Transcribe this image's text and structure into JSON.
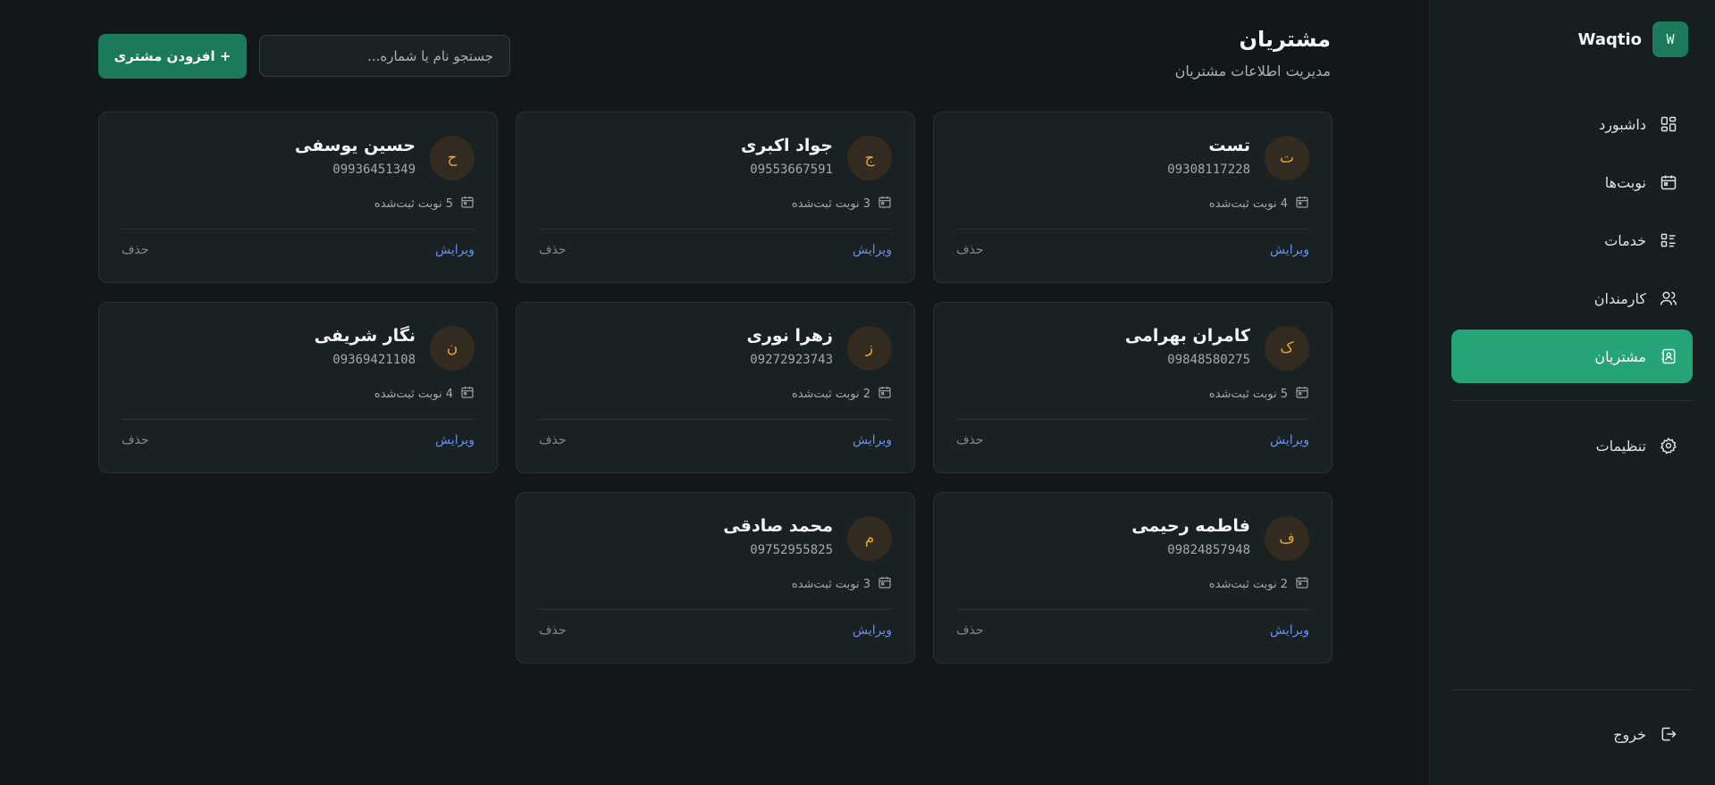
{
  "brand": {
    "logo_letter": "W",
    "name": "Waqtio"
  },
  "nav": {
    "items": [
      {
        "label": "داشبورد",
        "icon": "dashboard-icon"
      },
      {
        "label": "نوبت‌ها",
        "icon": "calendar-icon"
      },
      {
        "label": "خدمات",
        "icon": "services-list-icon"
      },
      {
        "label": "کارمندان",
        "icon": "users-icon"
      },
      {
        "label": "مشتریان",
        "icon": "contacts-book-icon",
        "active": true
      }
    ],
    "settings_label": "تنظیمات",
    "logout_label": "خروج"
  },
  "header": {
    "title": "مشتریان",
    "subtitle": "مدیریت اطلاعات مشتریان",
    "search_placeholder": "جستجو نام یا شماره...",
    "add_button": "+ افزودن مشتری"
  },
  "customers": [
    {
      "initial": "ت",
      "name": "تست",
      "phone": "09308117228",
      "appointments": "4 نوبت ثبت‌شده",
      "edit": "ویرایش",
      "delete": "حذف"
    },
    {
      "initial": "ج",
      "name": "جواد اکبری",
      "phone": "09553667591",
      "appointments": "3 نوبت ثبت‌شده",
      "edit": "ویرایش",
      "delete": "حذف"
    },
    {
      "initial": "ح",
      "name": "حسین یوسفی",
      "phone": "09936451349",
      "appointments": "5 نوبت ثبت‌شده",
      "edit": "ویرایش",
      "delete": "حذف"
    },
    {
      "initial": "ک",
      "name": "کامران بهرامی",
      "phone": "09848580275",
      "appointments": "5 نوبت ثبت‌شده",
      "edit": "ویرایش",
      "delete": "حذف"
    },
    {
      "initial": "ز",
      "name": "زهرا نوری",
      "phone": "09272923743",
      "appointments": "2 نوبت ثبت‌شده",
      "edit": "ویرایش",
      "delete": "حذف"
    },
    {
      "initial": "ن",
      "name": "نگار شریفی",
      "phone": "09369421108",
      "appointments": "4 نوبت ثبت‌شده",
      "edit": "ویرایش",
      "delete": "حذف"
    },
    {
      "initial": "ف",
      "name": "فاطمه رحیمی",
      "phone": "09824857948",
      "appointments": "2 نوبت ثبت‌شده",
      "edit": "ویرایش",
      "delete": "حذف"
    },
    {
      "initial": "م",
      "name": "محمد صادقی",
      "phone": "09752955825",
      "appointments": "3 نوبت ثبت‌شده",
      "edit": "ویرایش",
      "delete": "حذف"
    }
  ],
  "colors": {
    "background": "#121819",
    "sidebar": "#171e1f",
    "card": "#1a2122",
    "accent": "#24a477",
    "button": "#1a7a5a",
    "avatar_text": "#e5a43a",
    "link": "#6a8ef0"
  }
}
